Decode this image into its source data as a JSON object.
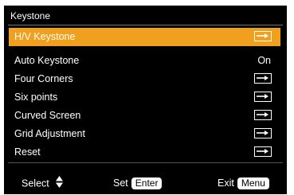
{
  "menu": {
    "title": "Keystone",
    "accent_color": "#f0a01d",
    "items": [
      {
        "label": "H/V Keystone",
        "type": "submenu",
        "selected": true,
        "icon": "arrow-right-icon"
      },
      {
        "label": "Auto Keystone",
        "type": "value",
        "value": "On"
      },
      {
        "label": "Four Corners",
        "type": "submenu",
        "icon": "arrow-right-icon"
      },
      {
        "label": "Six points",
        "type": "submenu",
        "icon": "arrow-right-icon"
      },
      {
        "label": "Curved Screen",
        "type": "submenu",
        "icon": "arrow-right-icon"
      },
      {
        "label": "Grid Adjustment",
        "type": "submenu",
        "icon": "arrow-right-icon"
      },
      {
        "label": "Reset",
        "type": "submenu",
        "icon": "arrow-right-icon"
      }
    ]
  },
  "footer": {
    "select_label": "Select",
    "select_icon": "up-down-arrows-icon",
    "set_label": "Set",
    "set_key": "Enter",
    "exit_label": "Exit",
    "exit_key": "Menu"
  }
}
